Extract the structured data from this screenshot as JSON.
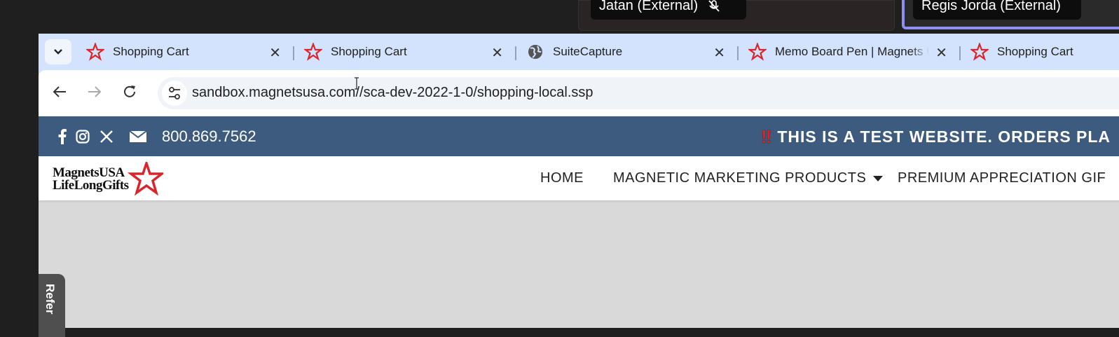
{
  "meeting": {
    "participant1": "Jatan (External)",
    "participant2": "Regis Jorda (External)",
    "mic_icon": "mic-off-icon"
  },
  "browser": {
    "tabs": [
      {
        "title": "Shopping Cart",
        "icon": "star-favicon"
      },
      {
        "title": "Shopping Cart",
        "icon": "star-favicon"
      },
      {
        "title": "SuiteCapture",
        "icon": "globe-favicon"
      },
      {
        "title": "Memo Board Pen | Magnets U",
        "icon": "star-favicon"
      },
      {
        "title": "Shopping Cart",
        "icon": "star-favicon"
      }
    ],
    "tab_close_glyph": "✕",
    "url": "sandbox.magnetsusa.com//sca-dev-2022-1-0/shopping-local.ssp"
  },
  "site": {
    "phone": "800.869.7562",
    "banner": "THIS IS A TEST WEBSITE. ORDERS PLA",
    "banner_prefix": "!!",
    "logo_line1": "MagnetsUSA",
    "logo_line2": "LifeLongGifts",
    "nav": {
      "home": "HOME",
      "magnetic": "MAGNETIC MARKETING PRODUCTS",
      "premium": "PREMIUM APPRECIATION GIF"
    },
    "refer_tab": "Refer"
  },
  "colors": {
    "promo_bar": "#3d5a7f",
    "tab_strip": "#d3e3fd",
    "star_red": "#d9262c"
  }
}
